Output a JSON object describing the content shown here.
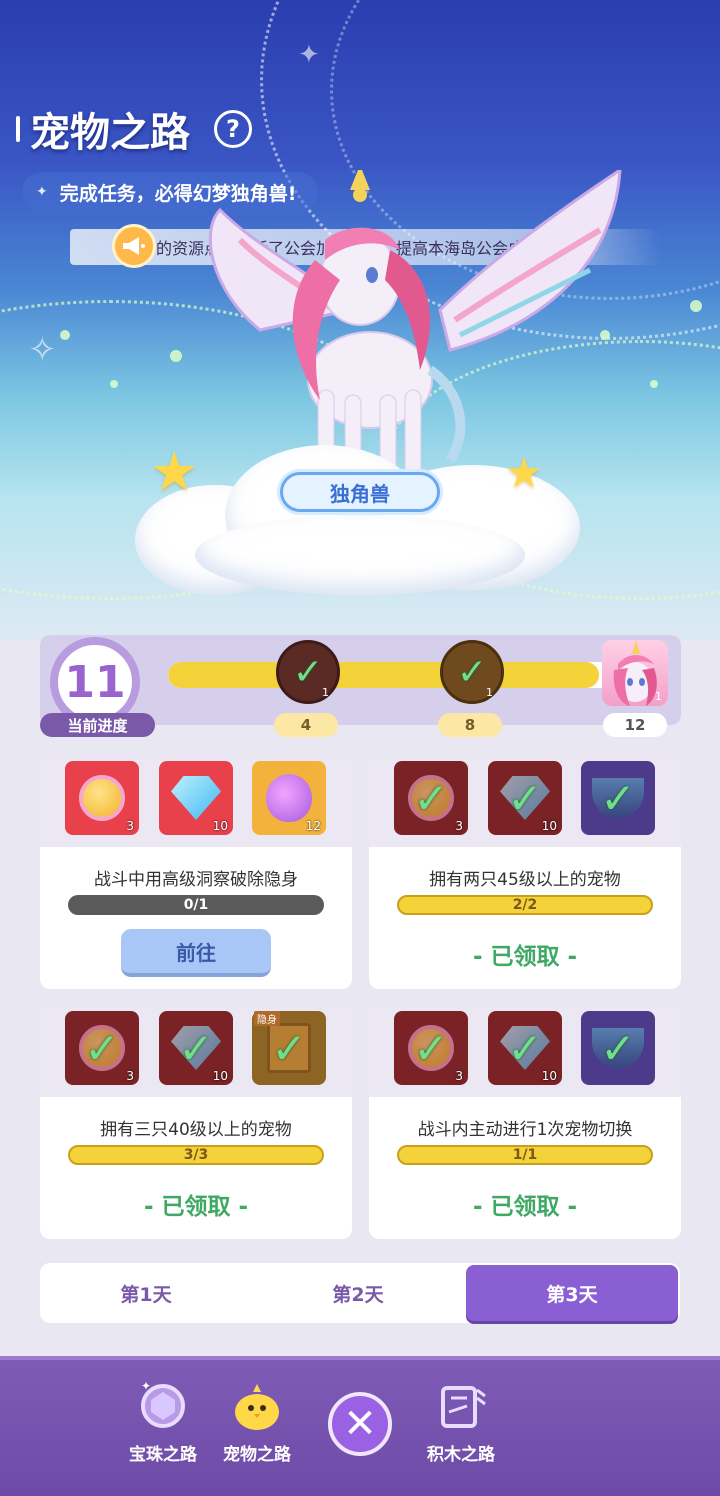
{
  "header": {
    "title": "宠物之路",
    "help_label": "?",
    "subtitle": "完成任务，必得幻梦独角兽!",
    "marquee": "的资源点，激活了公会加成效果，提高本海岛公会成员的资"
  },
  "pet": {
    "name": "独角兽"
  },
  "progress": {
    "current": "11",
    "label": "当前进度",
    "max": 12,
    "milestones": [
      {
        "value": "4",
        "qty": "1",
        "claimed": true
      },
      {
        "value": "8",
        "qty": "1",
        "claimed": true
      },
      {
        "value": "12",
        "qty": "1",
        "claimed": false
      }
    ]
  },
  "tasks": [
    {
      "description": "战斗中用高级洞察破除隐身",
      "progress_text": "0/1",
      "progress_fraction": 0,
      "action_label": "前往",
      "rewards": [
        {
          "icon": "coin-icon",
          "qty": "3",
          "claimed": false
        },
        {
          "icon": "diamond-icon",
          "qty": "10",
          "claimed": false
        },
        {
          "icon": "fruit-icon",
          "qty": "12",
          "claimed": false
        }
      ]
    },
    {
      "description": "拥有两只45级以上的宠物",
      "progress_text": "2/2",
      "progress_fraction": 1,
      "action_label": "- 已领取 -",
      "rewards": [
        {
          "icon": "coin-icon",
          "qty": "3",
          "claimed": true
        },
        {
          "icon": "diamond-icon",
          "qty": "10",
          "claimed": true
        },
        {
          "icon": "shield-icon",
          "qty": "",
          "claimed": true
        }
      ]
    },
    {
      "description": "拥有三只40级以上的宠物",
      "progress_text": "3/3",
      "progress_fraction": 1,
      "action_label": "- 已领取 -",
      "rewards": [
        {
          "icon": "coin-icon",
          "qty": "3",
          "claimed": true
        },
        {
          "icon": "diamond-icon",
          "qty": "10",
          "claimed": true
        },
        {
          "icon": "book-icon",
          "qty": "",
          "tag": "隐身",
          "claimed": true
        }
      ]
    },
    {
      "description": "战斗内主动进行1次宠物切换",
      "progress_text": "1/1",
      "progress_fraction": 1,
      "action_label": "- 已领取 -",
      "rewards": [
        {
          "icon": "coin-icon",
          "qty": "3",
          "claimed": true
        },
        {
          "icon": "diamond-icon",
          "qty": "10",
          "claimed": true
        },
        {
          "icon": "shield-icon",
          "qty": "",
          "claimed": true
        }
      ]
    }
  ],
  "day_tabs": [
    "第1天",
    "第2天",
    "第3天"
  ],
  "active_day": 2,
  "bottom_nav": {
    "items": [
      "宝珠之路",
      "宠物之路",
      "积木之路"
    ],
    "close_label": "✕"
  },
  "colors": {
    "accent_purple": "#8a5fd3",
    "progress_yellow": "#f4d23a",
    "claimed_green": "#3fa864"
  }
}
